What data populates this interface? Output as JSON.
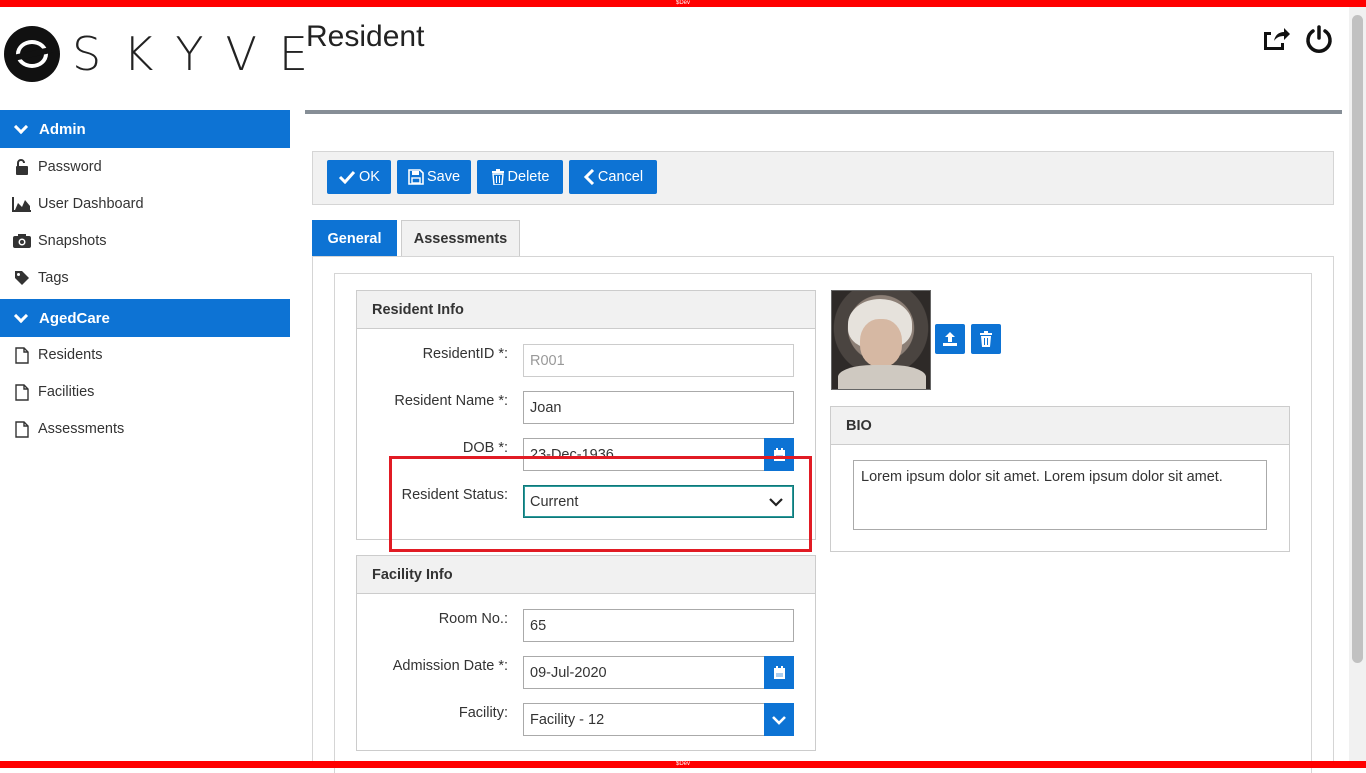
{
  "env": {
    "dev_label": "$Dev"
  },
  "brand": {
    "name": "SKYVE"
  },
  "sidebar": {
    "groups": [
      {
        "label": "Admin",
        "items": [
          {
            "label": "Password",
            "icon": "lock-open-icon"
          },
          {
            "label": "User Dashboard",
            "icon": "area-chart-icon"
          },
          {
            "label": "Snapshots",
            "icon": "camera-icon"
          },
          {
            "label": "Tags",
            "icon": "tag-icon"
          }
        ]
      },
      {
        "label": "AgedCare",
        "items": [
          {
            "label": "Residents",
            "icon": "document-icon"
          },
          {
            "label": "Facilities",
            "icon": "document-icon"
          },
          {
            "label": "Assessments",
            "icon": "document-icon"
          }
        ]
      }
    ]
  },
  "header": {
    "title": "Resident"
  },
  "toolbar": {
    "ok_label": "OK",
    "save_label": "Save",
    "delete_label": "Delete",
    "cancel_label": "Cancel"
  },
  "tabs": [
    {
      "label": "General"
    },
    {
      "label": "Assessments"
    }
  ],
  "resident_info": {
    "title": "Resident Info",
    "resident_id": {
      "label": "ResidentID *:",
      "value": "R001"
    },
    "resident_name": {
      "label": "Resident Name *:",
      "value": "Joan"
    },
    "dob": {
      "label": "DOB *:",
      "value": "23-Dec-1936"
    },
    "status": {
      "label": "Resident Status:",
      "value": "Current"
    }
  },
  "facility_info": {
    "title": "Facility Info",
    "room": {
      "label": "Room No.:",
      "value": "65"
    },
    "admission": {
      "label": "Admission Date *:",
      "value": "09-Jul-2020"
    },
    "facility": {
      "label": "Facility:",
      "value": "Facility - 12"
    }
  },
  "bio": {
    "title": "BIO",
    "text": "Lorem ipsum dolor sit amet. Lorem ipsum dolor sit amet."
  },
  "colors": {
    "accent": "#0d73d4",
    "highlight": "#e11b24",
    "devbar": "#ff0000"
  }
}
